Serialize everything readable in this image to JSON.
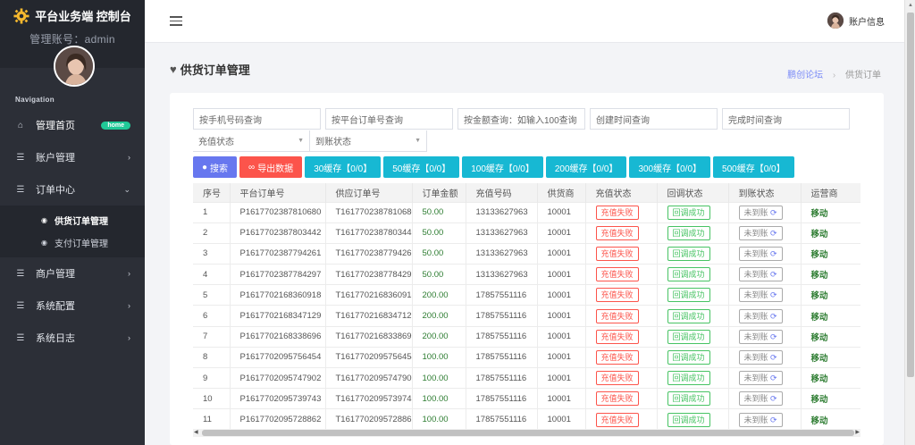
{
  "sidebar": {
    "brand": "平台业务端 控制台",
    "admin_line": "管理账号：admin",
    "nav_label": "Navigation",
    "items": [
      {
        "label": "管理首页",
        "badge": "home"
      },
      {
        "label": "账户管理"
      },
      {
        "label": "订单中心"
      },
      {
        "label": "商户管理"
      },
      {
        "label": "系统配置"
      },
      {
        "label": "系统日志"
      }
    ],
    "sub_items": [
      {
        "label": "供货订单管理"
      },
      {
        "label": "支付订单管理"
      }
    ]
  },
  "topbar": {
    "user_label": "账户信息"
  },
  "page": {
    "title": "供货订单管理",
    "breadcrumb": [
      "鹏创论坛",
      "供货订单"
    ]
  },
  "filters": {
    "phone_placeholder": "按手机号码查询",
    "platform_no_placeholder": "按平台订单号查询",
    "amount_placeholder": "按金额查询：如输入100查询",
    "created_placeholder": "创建时间查询",
    "finished_placeholder": "完成时间查询",
    "recharge_status": "充值状态",
    "arrival_status": "到账状态"
  },
  "buttons": {
    "search": "搜索",
    "export": "导出数据",
    "cache": [
      "30缓存【0/0】",
      "50缓存【0/0】",
      "100缓存【0/0】",
      "200缓存【0/0】",
      "300缓存【0/0】",
      "500缓存【0/0】"
    ]
  },
  "table": {
    "headers": [
      "序号",
      "平台订单号",
      "供应订单号",
      "订单金额",
      "充值号码",
      "供货商",
      "充值状态",
      "回调状态",
      "到账状态",
      "运营商"
    ],
    "rows": [
      {
        "no": "1",
        "platform": "P1617702387810680",
        "supply": "T1617702387810680",
        "amount": "50.00",
        "phone": "13133627963",
        "supplier": "10001",
        "recharge": "充值失败",
        "callback": "回调成功",
        "arrival": "未到账",
        "operator": "移动"
      },
      {
        "no": "2",
        "platform": "P1617702387803442",
        "supply": "T1617702387803442",
        "amount": "50.00",
        "phone": "13133627963",
        "supplier": "10001",
        "recharge": "充值失败",
        "callback": "回调成功",
        "arrival": "未到账",
        "operator": "移动"
      },
      {
        "no": "3",
        "platform": "P1617702387794261",
        "supply": "T1617702387794261",
        "amount": "50.00",
        "phone": "13133627963",
        "supplier": "10001",
        "recharge": "充值失败",
        "callback": "回调成功",
        "arrival": "未到账",
        "operator": "移动"
      },
      {
        "no": "4",
        "platform": "P1617702387784297",
        "supply": "T1617702387784297",
        "amount": "50.00",
        "phone": "13133627963",
        "supplier": "10001",
        "recharge": "充值失败",
        "callback": "回调成功",
        "arrival": "未到账",
        "operator": "移动"
      },
      {
        "no": "5",
        "platform": "P1617702168360918",
        "supply": "T1617702168360918",
        "amount": "200.00",
        "phone": "17857551116",
        "supplier": "10001",
        "recharge": "充值失败",
        "callback": "回调成功",
        "arrival": "未到账",
        "operator": "移动"
      },
      {
        "no": "6",
        "platform": "P1617702168347129",
        "supply": "T1617702168347129",
        "amount": "200.00",
        "phone": "17857551116",
        "supplier": "10001",
        "recharge": "充值失败",
        "callback": "回调成功",
        "arrival": "未到账",
        "operator": "移动"
      },
      {
        "no": "7",
        "platform": "P1617702168338696",
        "supply": "T1617702168338696",
        "amount": "200.00",
        "phone": "17857551116",
        "supplier": "10001",
        "recharge": "充值失败",
        "callback": "回调成功",
        "arrival": "未到账",
        "operator": "移动"
      },
      {
        "no": "8",
        "platform": "P1617702095756454",
        "supply": "T1617702095756454",
        "amount": "100.00",
        "phone": "17857551116",
        "supplier": "10001",
        "recharge": "充值失败",
        "callback": "回调成功",
        "arrival": "未到账",
        "operator": "移动"
      },
      {
        "no": "9",
        "platform": "P1617702095747902",
        "supply": "T1617702095747902",
        "amount": "100.00",
        "phone": "17857551116",
        "supplier": "10001",
        "recharge": "充值失败",
        "callback": "回调成功",
        "arrival": "未到账",
        "operator": "移动"
      },
      {
        "no": "10",
        "platform": "P1617702095739743",
        "supply": "T1617702095739743",
        "amount": "100.00",
        "phone": "17857551116",
        "supplier": "10001",
        "recharge": "充值失败",
        "callback": "回调成功",
        "arrival": "未到账",
        "operator": "移动"
      },
      {
        "no": "11",
        "platform": "P1617702095728862",
        "supply": "T1617702095728862",
        "amount": "100.00",
        "phone": "17857551116",
        "supplier": "10001",
        "recharge": "充值失败",
        "callback": "回调成功",
        "arrival": "未到账",
        "operator": "移动"
      }
    ]
  },
  "colors": {
    "primary": "#6777ef",
    "danger": "#fc544b",
    "info": "#17b8d3",
    "success": "#47c363",
    "sidebar_bg": "#2c2f37"
  }
}
